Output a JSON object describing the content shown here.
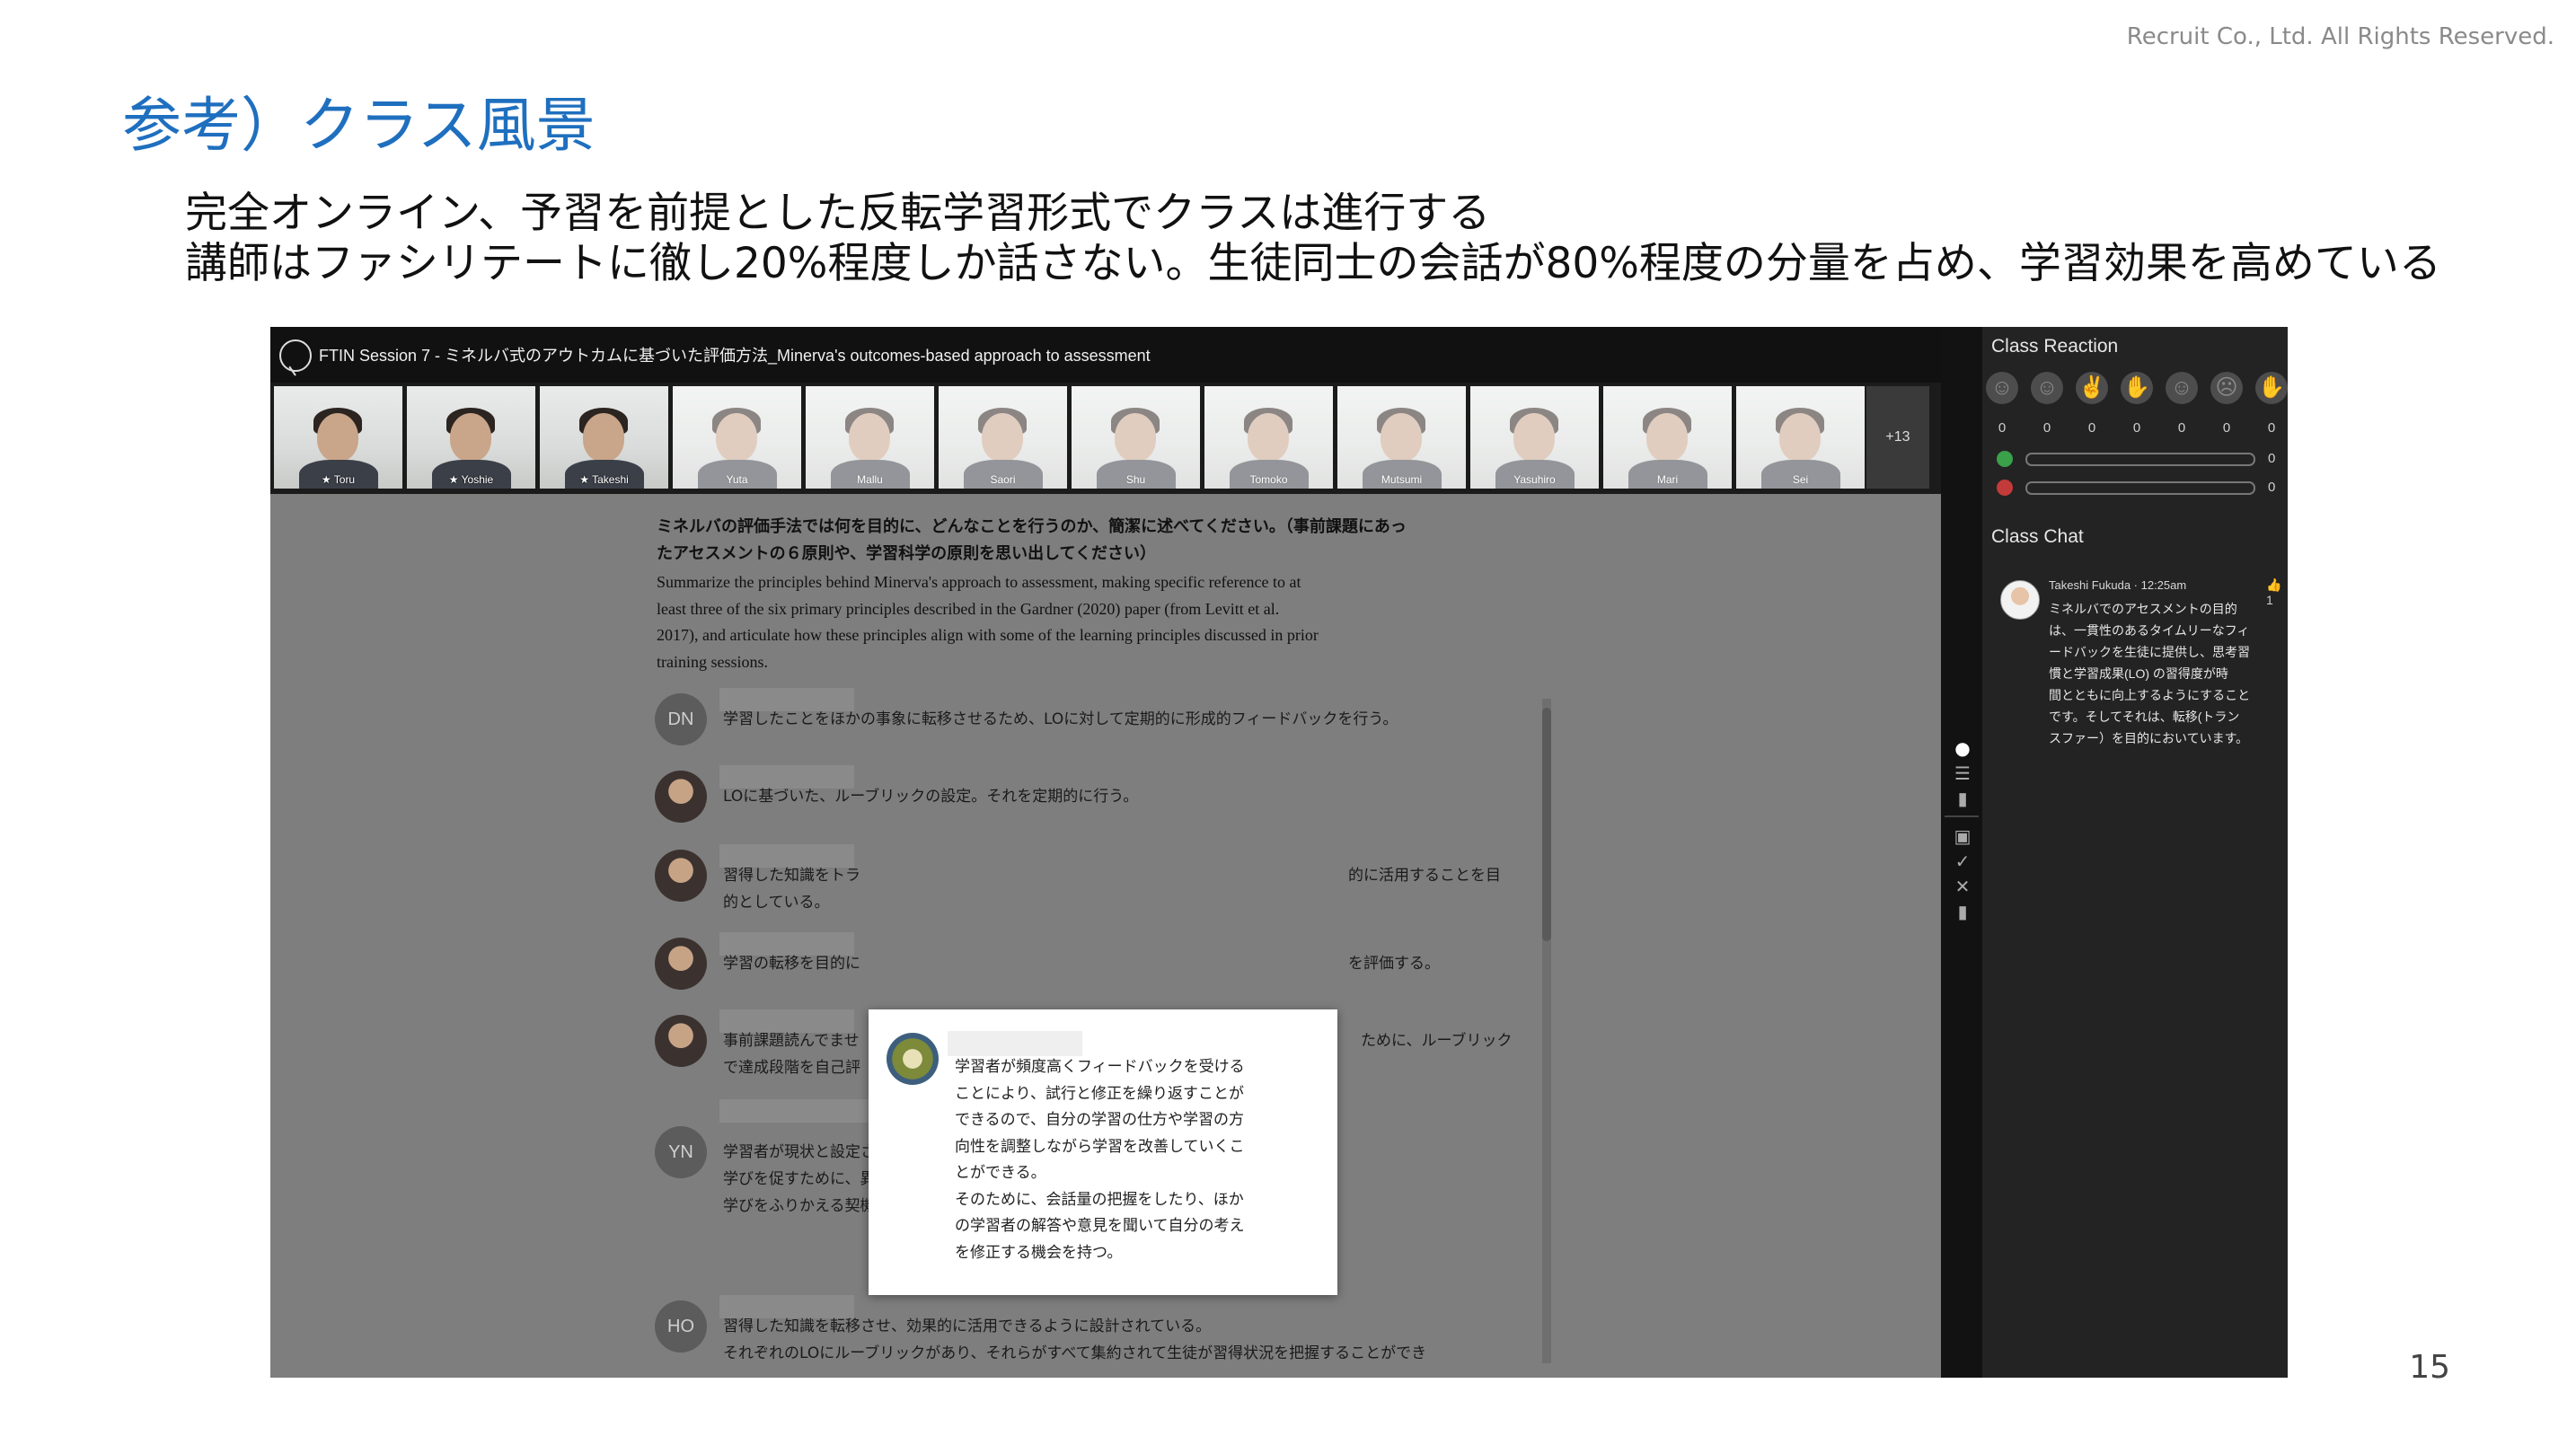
{
  "slide": {
    "copyright": "Recruit Co., Ltd. All Rights Reserved.",
    "title": "参考）クラス風景",
    "lead_line1": "完全オンライン、予習を前提とした反転学習形式でクラスは進行する",
    "lead_line2": "講師はファシリテートに徹し20%程度しか話さない。生徒同士の会話が80%程度の分量を占め、学習効果を高めている",
    "page_number": "15"
  },
  "app": {
    "window_title": "FTIN Session 7 - ミネルバ式のアウトカムに基づいた評価方法_Minerva's outcomes-based approach to assessment",
    "participants": [
      "★ Toru",
      "★ Yoshie",
      "★ Takeshi",
      "Yuta",
      "Mallu",
      "Saori",
      "Shu",
      "Tomoko",
      "Mutsumi",
      "Yasuhiro",
      "Mari",
      "Sei"
    ],
    "more_participants": "+13"
  },
  "question": {
    "ja_line1": "ミネルバの評価手法では何を目的に、どんなことを行うのか、簡潔に述べてください。（事前課題にあっ",
    "ja_line2": "たアセスメントの６原則や、学習科学の原則を思い出してください）",
    "en_line1": "Summarize the principles behind Minerva's approach to assessment, making specific reference to at",
    "en_line2": "least three of the six primary principles described in the Gardner (2020) paper (from Levitt et al.",
    "en_line3": "2017), and articulate how these principles align with some of the learning principles discussed in prior",
    "en_line4": "training sessions."
  },
  "comments": [
    {
      "initials": "DN",
      "lines": [
        "学習したことをほかの事象に転移させるため、LOに対して定期的に形成的フィードバックを行う。"
      ]
    },
    {
      "initials": "",
      "lines": [
        "LOに基づいた、ルーブリックの設定。それを定期的に行う。"
      ]
    },
    {
      "initials": "",
      "lines": [
        "習得した知識をトラ",
        "的としている。"
      ],
      "right_line": "的に活用することを目"
    },
    {
      "initials": "",
      "lines": [
        "学習の転移を目的に"
      ],
      "right_line": "を評価する。"
    },
    {
      "initials": "",
      "lines": [
        "事前課題読んでませ",
        "で達成段階を自己評"
      ],
      "right_line": "ために、ルーブリック"
    },
    {
      "initials": "YN",
      "lines": [
        "学習者が現状と設定されたゴールとの距離を確認するため。",
        "学びを促すために、異なる観点を示したり、より難しい到達点を共有したりするため。",
        "学びをふりかえる契機とするため。"
      ]
    },
    {
      "initials": "HO",
      "lines": [
        "習得した知識を転移させ、効果的に活用できるように設計されている。",
        "それぞれのLOにルーブリックがあり、それらがすべて集約されて生徒が習得状況を把握することができ"
      ]
    }
  ],
  "popup": {
    "lines": [
      "学習者が頻度高くフィードバックを受ける",
      "ことにより、試行と修正を繰り返すことが",
      "できるので、自分の学習の仕方や学習の方",
      "向性を調整しながら学習を改善していくこ",
      "とができる。",
      "そのために、会話量の把握をしたり、ほか",
      "の学習者の解答や意見を聞いて自分の考え",
      "を修正する機会を持つ。"
    ]
  },
  "reaction": {
    "heading": "Class Reaction",
    "emoji": [
      "smile",
      "neutral",
      "thumbs-up",
      "raised-hand",
      "laugh",
      "surprised",
      "clap"
    ],
    "counts": [
      "0",
      "0",
      "0",
      "0",
      "0",
      "0",
      "0"
    ],
    "votes": [
      {
        "color": "#3aa04a",
        "value": 0,
        "label": "0"
      },
      {
        "color": "#c33a3a",
        "value": 0,
        "label": "0"
      }
    ]
  },
  "chat": {
    "heading": "Class Chat",
    "author": "Takeshi Fukuda · 12:25am",
    "likes": "1",
    "lines": [
      "ミネルバでのアセスメントの目的",
      "は、一貫性のあるタイムリーなフィ",
      "ードバックを生徒に提供し、思考習",
      "慣と学習成果(LO) の習得度が時",
      "間とともに向上するようにすること",
      "です。そしてそれは、転移(トラン",
      "スファー）を目的においています。"
    ]
  }
}
